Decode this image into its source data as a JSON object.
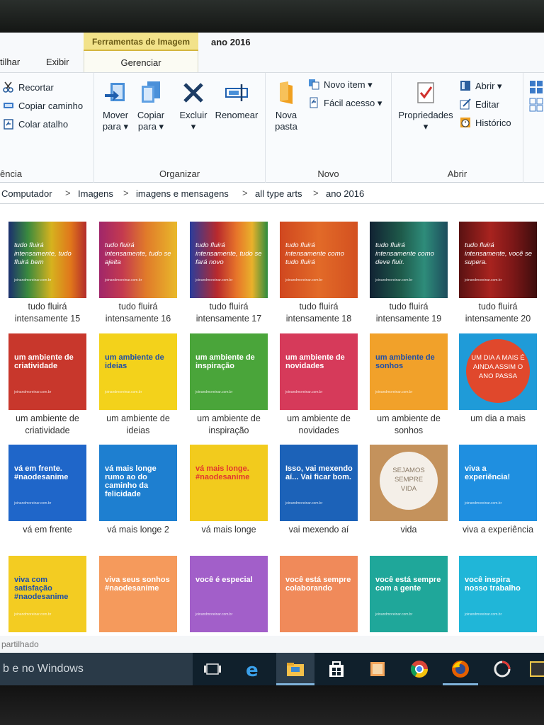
{
  "ribbon_tabs": {
    "compartilhar": "tilhar",
    "exibir": "Exibir"
  },
  "context_tab": {
    "header": "Ferramentas de Imagem",
    "label": "Gerenciar"
  },
  "window_title": "ano 2016",
  "ribbon": {
    "clipboard": {
      "recortar": "Recortar",
      "copiar_caminho": "Copiar caminho",
      "colar_atalho": "Colar atalho",
      "group": "ência"
    },
    "organizar": {
      "mover_1": "Mover",
      "mover_2": "para ▾",
      "copiar_1": "Copiar",
      "copiar_2": "para ▾",
      "excluir": "Excluir",
      "excluir_arrow": "▾",
      "renomear": "Renomear",
      "group": "Organizar"
    },
    "novo": {
      "nova_1": "Nova",
      "nova_2": "pasta",
      "novo_item": "Novo item ▾",
      "facil_acesso": "Fácil acesso ▾",
      "group": "Novo"
    },
    "abrir": {
      "propriedades": "Propriedades",
      "prop_arrow": "▾",
      "abrir": "Abrir ▾",
      "editar": "Editar",
      "historico": "Histórico",
      "group": "Abrir"
    }
  },
  "breadcrumb": [
    "Computador",
    "Imagens",
    "imagens e mensagens",
    "all type arts",
    "ano 2016"
  ],
  "breadcrumb_sep": ">",
  "files": [
    {
      "line1": "tudo fluirá",
      "line2": "intensamente 15",
      "thumb": "tudo fluirá intensamente, tudo fluirá bem",
      "bg": "rainbow1",
      "small": "joinandmoreinar.com.br"
    },
    {
      "line1": "tudo fluirá",
      "line2": "intensamente 16",
      "thumb": "tudo fluirá intensamente, tudo se ajeita",
      "bg": "rainbow2",
      "small": "joinandmoreinar.com.br"
    },
    {
      "line1": "tudo fluirá",
      "line2": "intensamente 17",
      "thumb": "tudo fluirá intensamente, tudo se fará novo",
      "bg": "rainbow3",
      "small": "joinandmoreinar.com.br"
    },
    {
      "line1": "tudo fluirá",
      "line2": "intensamente 18",
      "thumb": "tudo fluirá intensamente como tudo fluirá",
      "bg": "rainbow4",
      "small": "joinandmoreinar.com.br"
    },
    {
      "line1": "tudo fluirá",
      "line2": "intensamente 19",
      "thumb": "tudo fluirá intensamente como deve fluir.",
      "bg": "rainbow5",
      "small": "joinandmoreinar.com.br"
    },
    {
      "line1": "tudo fluirá",
      "line2": "intensamente 20",
      "thumb": "tudo fluirá intensamente, você se supera.",
      "bg": "rainbow6",
      "small": "joinandmoreinar.com.br"
    },
    {
      "line1": "um ambiente de",
      "line2": "criatividade",
      "thumb": "um ambiente de criatividade",
      "bg": "#c8372c",
      "small": "joinandmoreinar.com.br"
    },
    {
      "line1": "um ambiente de",
      "line2": "ideias",
      "thumb": "um ambiente de ideias",
      "bg": "#f3d21b",
      "small": "joinandmoreinar.com.br"
    },
    {
      "line1": "um ambiente de",
      "line2": "inspiração",
      "thumb": "um ambiente de inspiração",
      "bg": "#4aa53a",
      "small": "joinandmoreinar.com.br"
    },
    {
      "line1": "um ambiente de",
      "line2": "novidades",
      "thumb": "um ambiente de novidades",
      "bg": "#d63a5a",
      "small": "joinandmoreinar.com.br"
    },
    {
      "line1": "um ambiente de",
      "line2": "sonhos",
      "thumb": "um ambiente de sonhos",
      "bg": "#f1a12a",
      "small": "joinandmoreinar.com.br"
    },
    {
      "line1": "um dia a mais",
      "line2": "",
      "thumb": "UM DIA A MAIS É AINDA ASSIM O ANO PASSA",
      "bg": "circle",
      "small": ""
    },
    {
      "line1": "vá em frente",
      "line2": "",
      "thumb": "vá em frente. #naodesanime",
      "bg": "#1f66c9",
      "small": "joinandmoreinar.com.br"
    },
    {
      "line1": "vá mais longe 2",
      "line2": "",
      "thumb": "vá mais longe rumo ao do caminho da felicidade",
      "bg": "#1e7fd0",
      "small": ""
    },
    {
      "line1": "vá mais longe",
      "line2": "",
      "thumb": "vá mais longe. #naodesanime",
      "bg": "#f2cb1d",
      "small": ""
    },
    {
      "line1": "vai mexendo aí",
      "line2": "",
      "thumb": "Isso, vai mexendo aí... Vai ficar bom.",
      "bg": "#1c62b8",
      "small": "joinandmoreinar.com.br"
    },
    {
      "line1": "vida",
      "line2": "",
      "thumb": "SEJAMOS SEMPRE VIDA",
      "bg": "vida",
      "small": ""
    },
    {
      "line1": "viva a experiência",
      "line2": "",
      "thumb": "viva a experiência!",
      "bg": "#1f8fe0",
      "small": "joinandmoreinar.com.br"
    },
    {
      "line1": "viva com",
      "line2": "satisfação",
      "thumb": "viva com satisfação #naodesanime",
      "bg": "#f3cc22",
      "small": "joinandmoreinar.com.br"
    },
    {
      "line1": "viva seus sonhos",
      "line2": "",
      "thumb": "viva seus sonhos #naodesanime",
      "bg": "#f59a5c",
      "small": ""
    },
    {
      "line1": "você é especial",
      "line2": "",
      "thumb": "você é especial",
      "bg": "#a25fc9",
      "small": "joinandmoreinar.com.br"
    },
    {
      "line1": "você está sempre",
      "line2": "colaborando",
      "thumb": "você está sempre colaborando",
      "bg": "#f08a5a",
      "small": ""
    },
    {
      "line1": "você está sempre",
      "line2": "com a gente",
      "thumb": "você está sempre com a gente",
      "bg": "#1fa79a",
      "small": "joinandmoreinar.com.br"
    },
    {
      "line1": "você inspira",
      "line2": "nosso trabalho",
      "thumb": "você inspira nosso trabalho",
      "bg": "#20b6d8",
      "small": "joinandmoreinar.com.br"
    }
  ],
  "status_text": "partilhado",
  "taskbar": {
    "search_text": "b e no Windows"
  },
  "icons": [
    "cut-icon",
    "copy-path-icon",
    "paste-shortcut-icon",
    "move-to-icon",
    "copy-to-icon",
    "delete-icon",
    "rename-icon",
    "new-folder-icon",
    "new-item-icon",
    "easy-access-icon",
    "properties-icon",
    "open-icon",
    "edit-icon",
    "history-icon",
    "select-icon",
    "task-view-icon",
    "edge-icon",
    "file-explorer-icon",
    "store-icon",
    "paint-icon",
    "chrome-icon",
    "firefox-icon",
    "app-icon"
  ]
}
